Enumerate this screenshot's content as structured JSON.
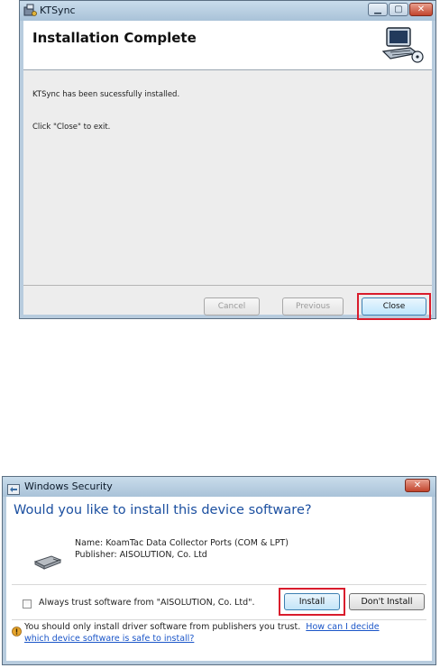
{
  "installer": {
    "window_title": "KTSync",
    "heading": "Installation Complete",
    "message": "KTSync has been sucessfully installed.",
    "instruction": "Click \"Close\" to exit.",
    "buttons": {
      "cancel": "Cancel",
      "previous": "Previous",
      "close": "Close"
    },
    "icons": [
      "app-icon",
      "computer-install-icon"
    ]
  },
  "security": {
    "window_title": "Windows Security",
    "heading": "Would you like to install this device software?",
    "device_name": "Name: KoamTac Data Collector Ports (COM & LPT)",
    "publisher": "Publisher: AISOLUTION, Co. Ltd",
    "trust_checkbox": {
      "label": "Always trust software from \"AISOLUTION, Co. Ltd\".",
      "checked": false
    },
    "buttons": {
      "install": "Install",
      "dont_install": "Don't Install"
    },
    "warning_text": "You should only install driver software from publishers you trust.",
    "help_link": "How can I decide which device software is safe to install?",
    "icons": [
      "shield-icon",
      "device-icon",
      "warning-icon"
    ]
  },
  "colors": {
    "highlight": "#d91c2c",
    "link": "#1a55c8",
    "heading_blue": "#1b4fa0"
  }
}
